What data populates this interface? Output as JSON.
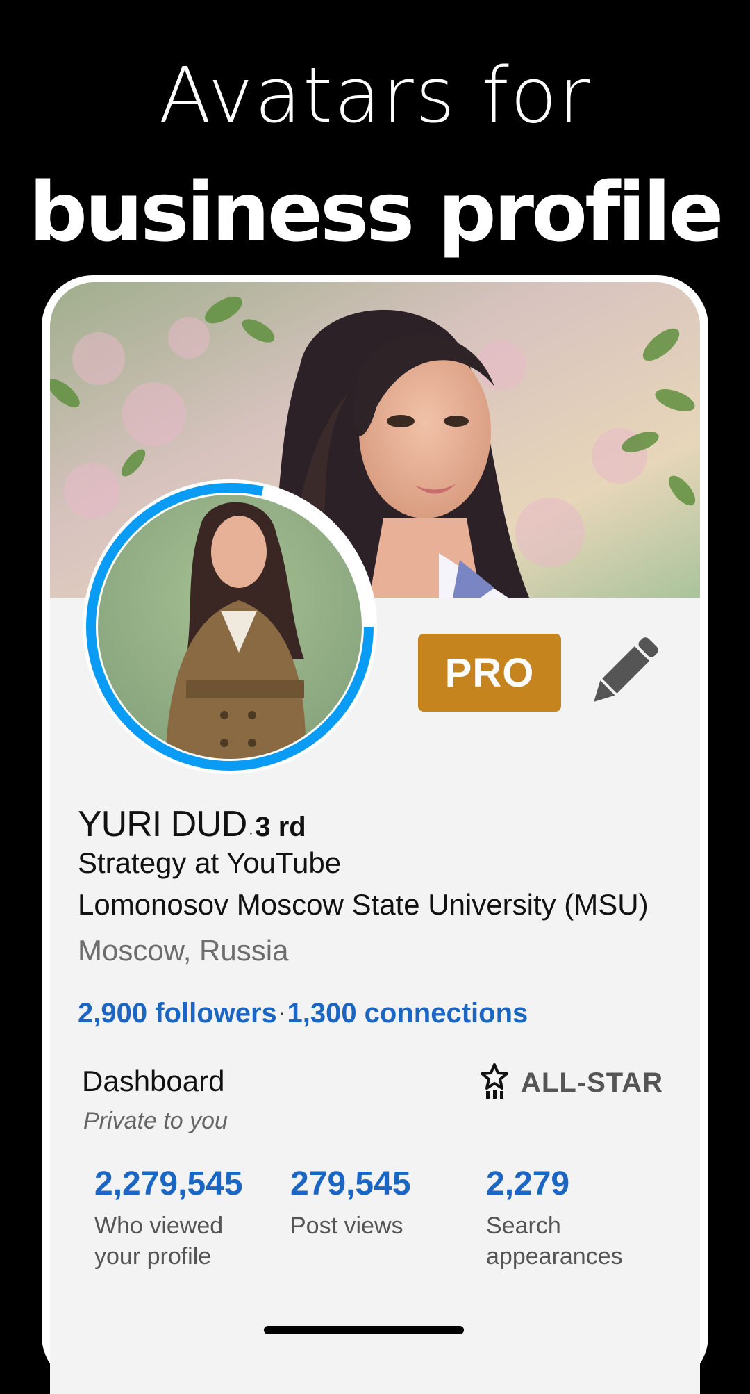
{
  "promo": {
    "line1": "Avatars for",
    "line2": "business profile"
  },
  "profile": {
    "name": "YURI DUD",
    "degree_separator": "·",
    "degree": "3 rd",
    "headline": "Strategy at YouTube",
    "education": "Lomonosov Moscow State University (MSU)",
    "location": "Moscow, Russia",
    "followers": "2,900 followers",
    "network_separator": "·",
    "connections": "1,300 connections",
    "pro_badge": "PRO"
  },
  "dashboard": {
    "title": "Dashboard",
    "subtitle": "Private to you",
    "badge_label": "ALL-STAR",
    "badge_icon": "all-star-icon",
    "stats": [
      {
        "value": "2,279,545",
        "label": "Who viewed your profile"
      },
      {
        "value": "279,545",
        "label": "Post views"
      },
      {
        "value": "2,279",
        "label": "Search appearances"
      }
    ]
  },
  "colors": {
    "accent_blue": "#1a66c2",
    "pro_gold": "#c6841f",
    "avatar_ring": "#0a9bf5",
    "screen_bg": "#f3f3f3"
  },
  "icons": {
    "edit": "pencil-icon"
  }
}
